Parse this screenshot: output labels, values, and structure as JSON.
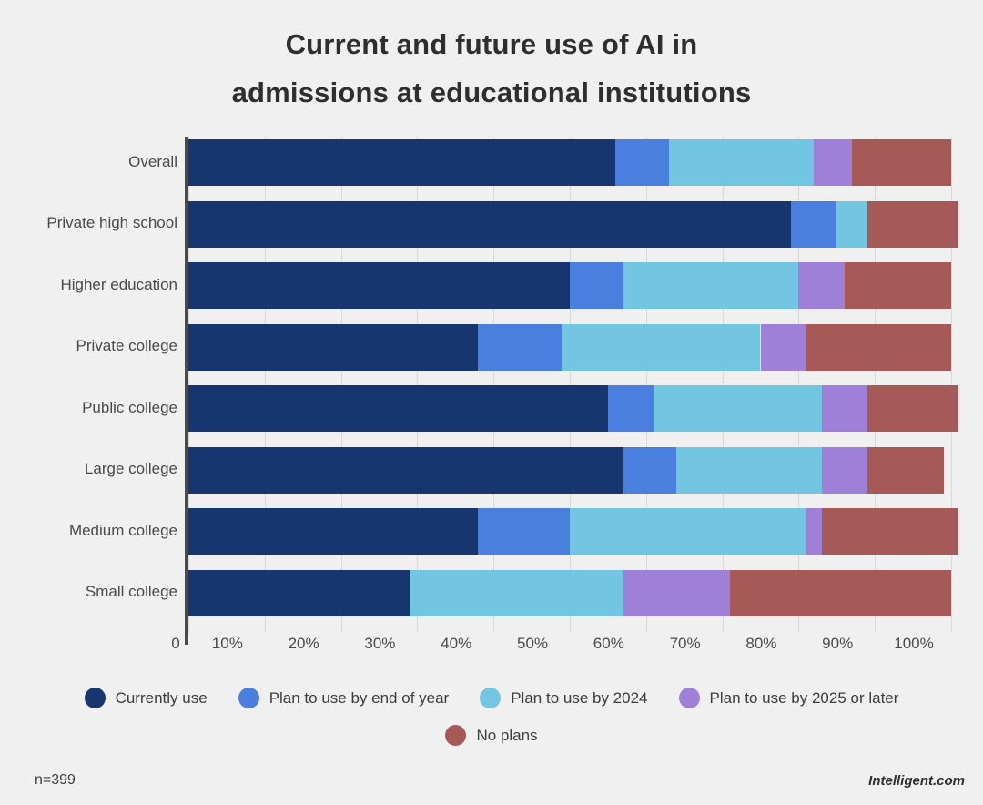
{
  "title": {
    "line1": "Current and future use of AI in",
    "line2": "admissions at educational institutions"
  },
  "footer": {
    "sample": "n=399",
    "brand": "Intelligent.com"
  },
  "chart_data": {
    "type": "bar",
    "orientation": "horizontal",
    "stacked": true,
    "normalized_percent": true,
    "title": "Current and future use of AI in admissions at educational institutions",
    "xlabel": "",
    "ylabel": "",
    "xlim": [
      0,
      100
    ],
    "xticks": [
      0,
      10,
      20,
      30,
      40,
      50,
      60,
      70,
      80,
      90,
      100
    ],
    "xtick_labels": [
      "0",
      "10%",
      "20%",
      "30%",
      "40%",
      "50%",
      "60%",
      "70%",
      "80%",
      "90%",
      "100%"
    ],
    "grid": true,
    "legend_position": "bottom",
    "categories": [
      "Overall",
      "Private high school",
      "Higher education",
      "Private college",
      "Public college",
      "Large college",
      "Medium college",
      "Small college"
    ],
    "series": [
      {
        "name": "Currently use",
        "color": "#17356f",
        "values": [
          56,
          79,
          50,
          38,
          55,
          57,
          38,
          29
        ]
      },
      {
        "name": "Plan to use by end of year",
        "color": "#4a7fe0",
        "values": [
          7,
          6,
          7,
          11,
          6,
          7,
          12,
          0
        ]
      },
      {
        "name": "Plan to use by 2024",
        "color": "#73c6e2",
        "values": [
          19,
          4,
          23,
          26,
          22,
          19,
          31,
          28
        ]
      },
      {
        "name": "Plan to use by 2025 or later",
        "color": "#9e80d8",
        "values": [
          5,
          0,
          6,
          6,
          6,
          6,
          2,
          14
        ]
      },
      {
        "name": "No plans",
        "color": "#a65a57",
        "values": [
          13,
          12,
          14,
          19,
          12,
          10,
          18,
          29
        ]
      }
    ]
  }
}
